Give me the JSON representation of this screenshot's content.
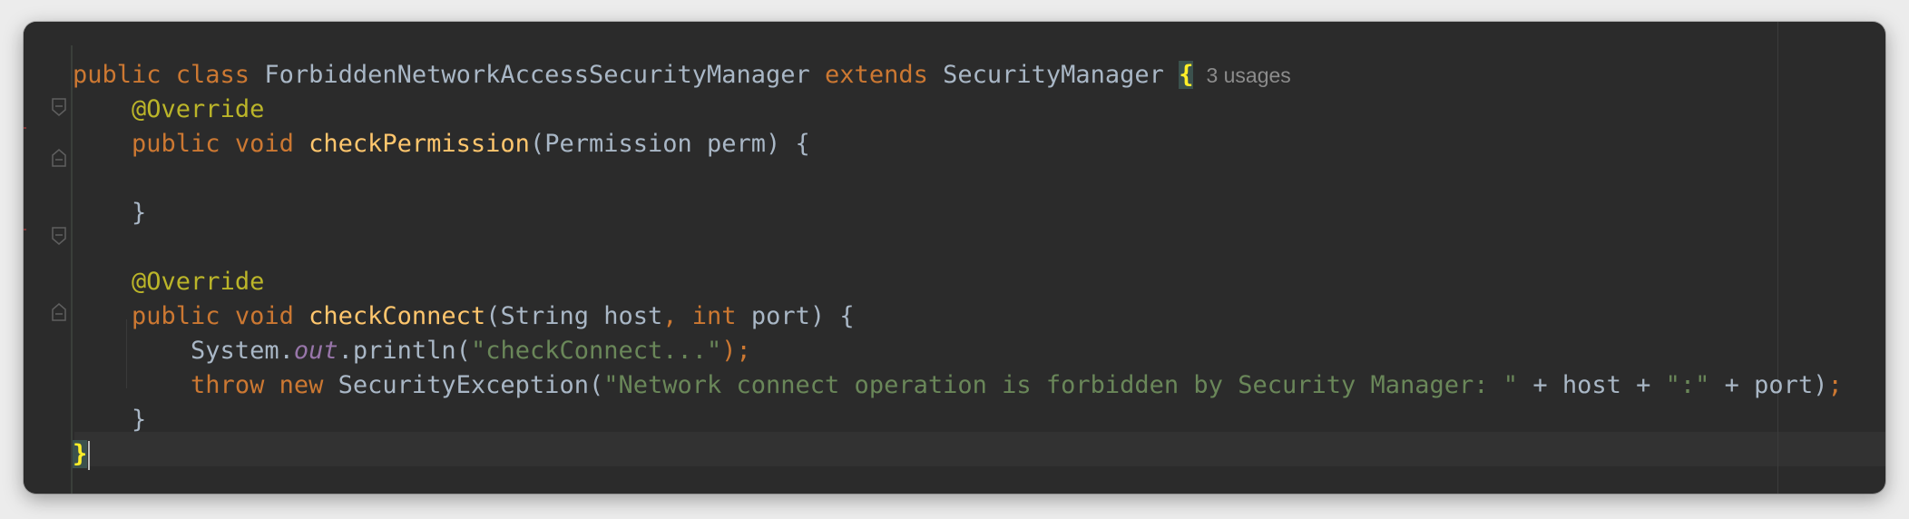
{
  "editor": {
    "lines": [
      {
        "tokens": [
          {
            "t": "public class ",
            "c": "kw"
          },
          {
            "t": "ForbiddenNetworkAccessSecurityManager ",
            "c": "plain"
          },
          {
            "t": "extends ",
            "c": "kw"
          },
          {
            "t": "SecurityManager ",
            "c": "plain"
          },
          {
            "t": "{",
            "c": "brace-hl"
          }
        ],
        "hint": "3 usages"
      },
      {
        "tokens": [
          {
            "t": "    ",
            "c": "plain"
          },
          {
            "t": "@Override",
            "c": "ann"
          }
        ]
      },
      {
        "tokens": [
          {
            "t": "    ",
            "c": "plain"
          },
          {
            "t": "public void ",
            "c": "kw"
          },
          {
            "t": "checkPermission",
            "c": "fn"
          },
          {
            "t": "(Permission perm) {",
            "c": "plain"
          }
        ]
      },
      {
        "tokens": []
      },
      {
        "tokens": [
          {
            "t": "    }",
            "c": "plain"
          }
        ]
      },
      {
        "tokens": []
      },
      {
        "tokens": [
          {
            "t": "    ",
            "c": "plain"
          },
          {
            "t": "@Override",
            "c": "ann"
          }
        ]
      },
      {
        "tokens": [
          {
            "t": "    ",
            "c": "plain"
          },
          {
            "t": "public void ",
            "c": "kw"
          },
          {
            "t": "checkConnect",
            "c": "fn"
          },
          {
            "t": "(String host",
            "c": "plain"
          },
          {
            "t": ", ",
            "c": "punc"
          },
          {
            "t": "int ",
            "c": "kw"
          },
          {
            "t": "port) {",
            "c": "plain"
          }
        ]
      },
      {
        "tokens": [
          {
            "t": "        System.",
            "c": "plain"
          },
          {
            "t": "out",
            "c": "fld"
          },
          {
            "t": ".println(",
            "c": "plain"
          },
          {
            "t": "\"checkConnect...\"",
            "c": "str"
          },
          {
            "t": ");",
            "c": "punc"
          }
        ]
      },
      {
        "tokens": [
          {
            "t": "        ",
            "c": "plain"
          },
          {
            "t": "throw new ",
            "c": "kw"
          },
          {
            "t": "SecurityException(",
            "c": "plain"
          },
          {
            "t": "\"Network connect operation is forbidden by Security Manager: \"",
            "c": "str"
          },
          {
            "t": " + host + ",
            "c": "plain"
          },
          {
            "t": "\":\"",
            "c": "str"
          },
          {
            "t": " + port)",
            "c": "plain"
          },
          {
            "t": ";",
            "c": "punc"
          }
        ]
      },
      {
        "tokens": [
          {
            "t": "    }",
            "c": "plain"
          }
        ]
      },
      {
        "tokens": [
          {
            "t": "}",
            "c": "brace-hl"
          }
        ],
        "caret": true
      }
    ]
  },
  "colors": {
    "background": "#2b2b2b",
    "keyword": "#cc7832",
    "annotation": "#bbb529",
    "method": "#ffc66d",
    "string": "#6a8759",
    "static_field": "#9876aa",
    "default_text": "#a9b7c6"
  }
}
